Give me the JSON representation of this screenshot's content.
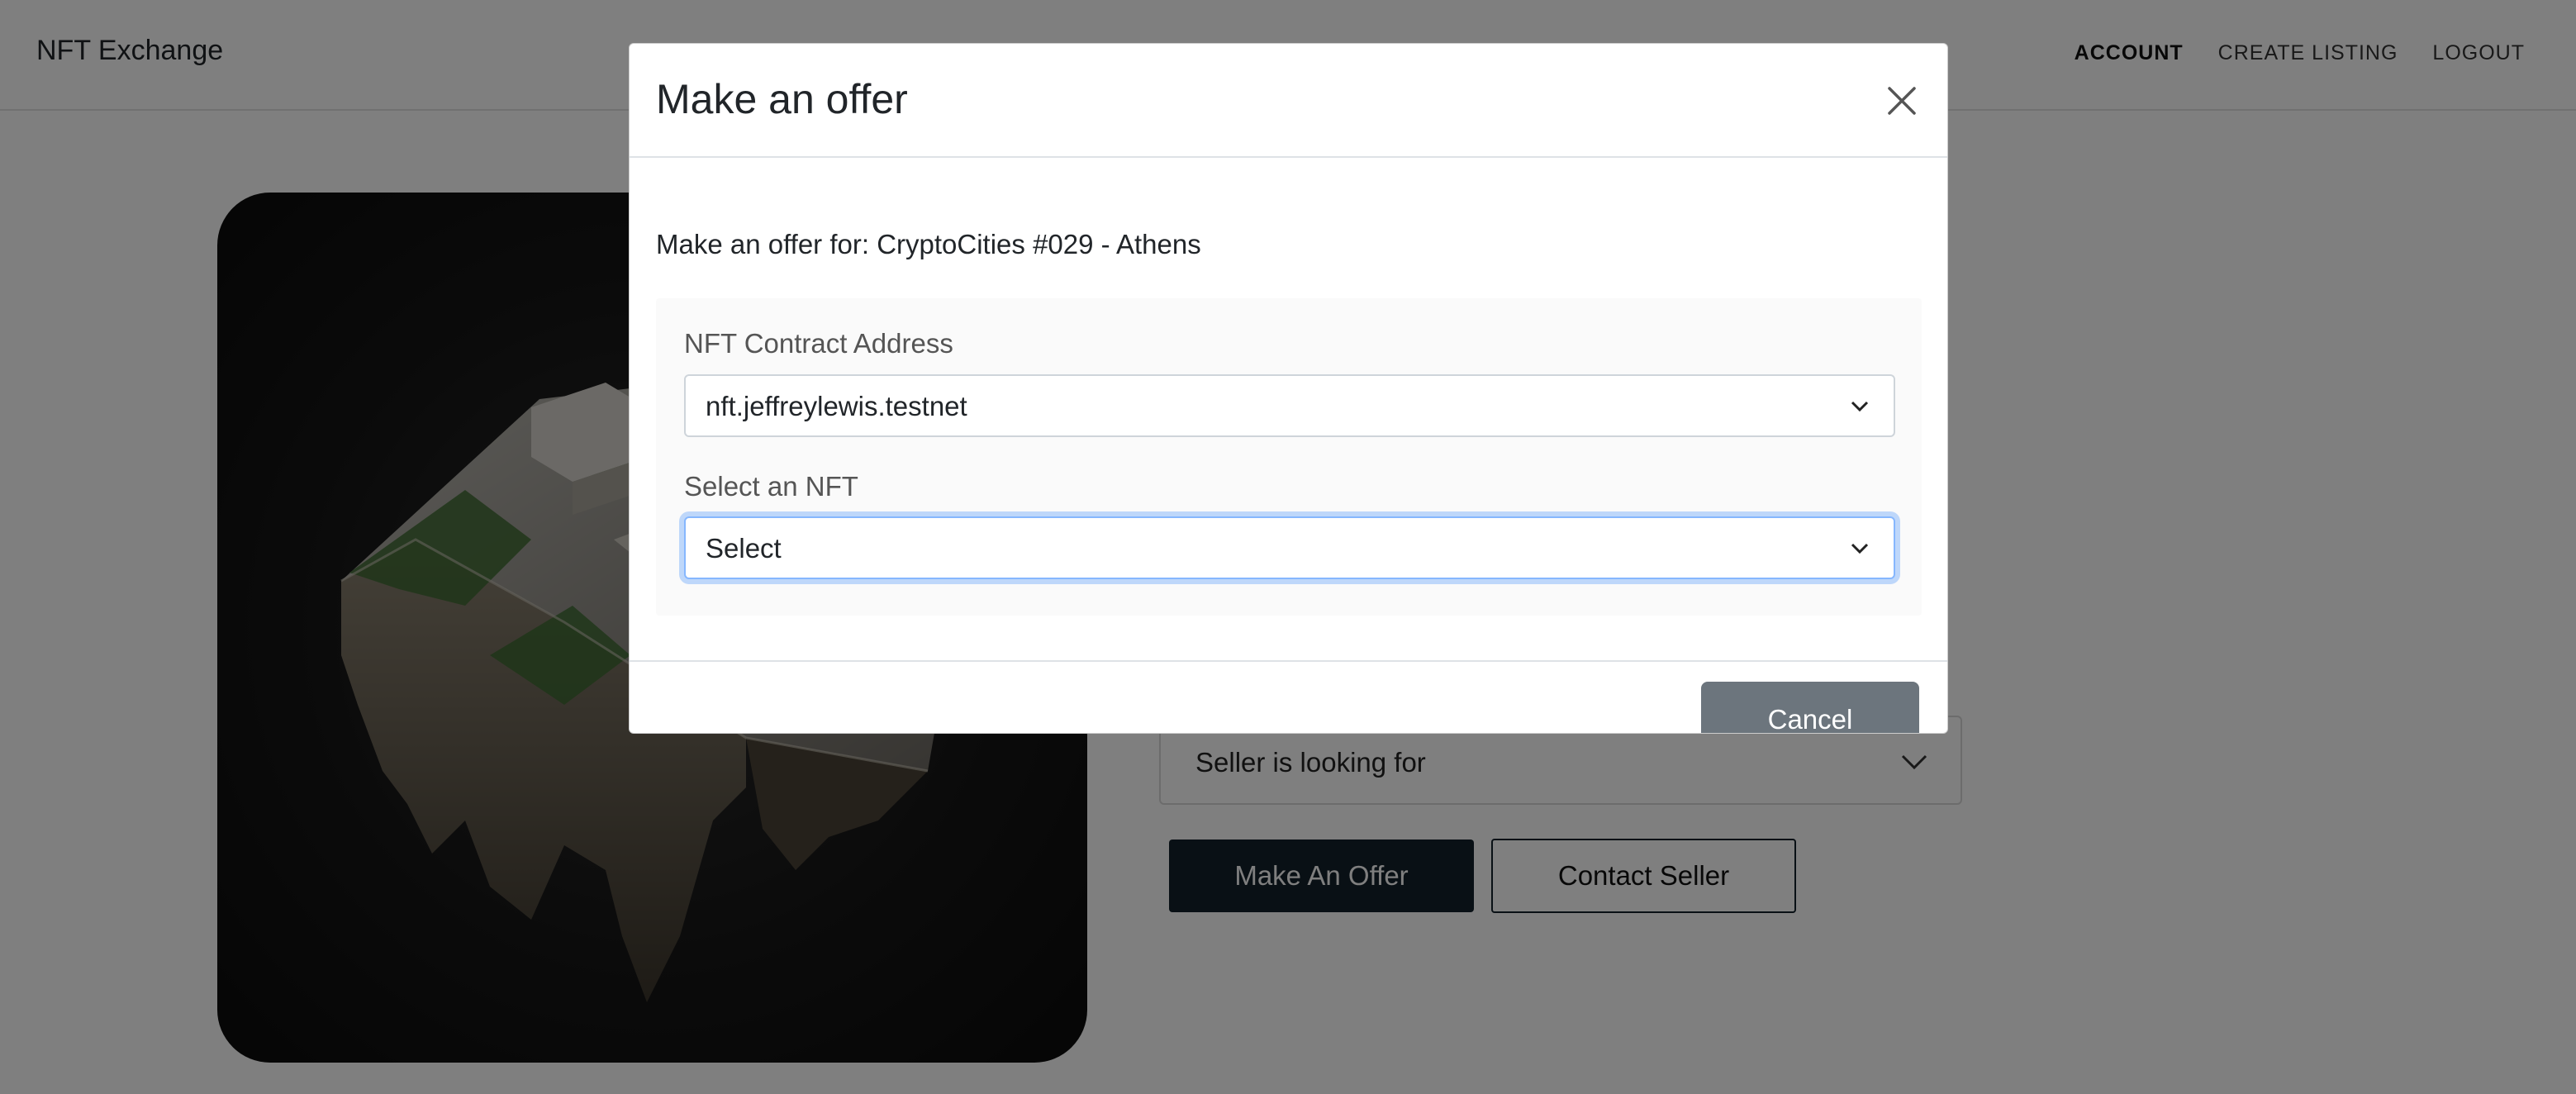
{
  "navbar": {
    "brand": "NFT Exchange",
    "links": [
      {
        "label": "ACCOUNT",
        "active": true
      },
      {
        "label": "CREATE LISTING",
        "active": false
      },
      {
        "label": "LOGOUT",
        "active": false
      }
    ]
  },
  "listing": {
    "looking_for_label": "Seller is looking for",
    "make_offer_label": "Make An Offer",
    "contact_seller_label": "Contact Seller"
  },
  "modal": {
    "title": "Make an offer",
    "offer_for_text": "Make an offer for: CryptoCities #029 - Athens",
    "contract_label": "NFT Contract Address",
    "contract_value": "nft.jeffreylewis.testnet",
    "nft_label": "Select an NFT",
    "nft_value": "Select",
    "cancel_label": "Cancel"
  },
  "icons": {
    "close": "close-icon",
    "chevron": "chevron-down-icon"
  },
  "colors": {
    "primary_dark": "#12202a",
    "secondary": "#6c757d",
    "focus_ring": "#86b7fe",
    "backdrop": "rgba(0,0,0,0.5)"
  }
}
